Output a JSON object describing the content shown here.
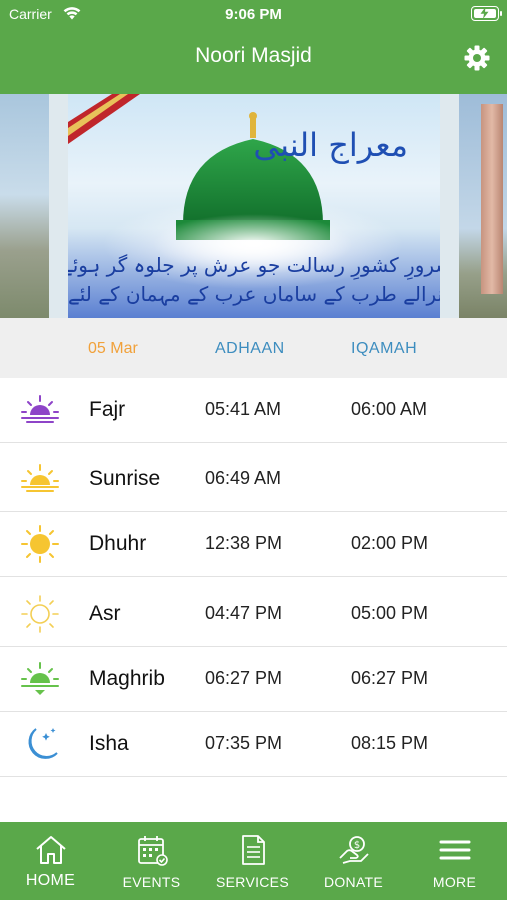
{
  "status_bar": {
    "carrier": "Carrier",
    "time": "9:06 PM",
    "icons": [
      "wifi-icon",
      "battery-charging-icon"
    ]
  },
  "header": {
    "title": "Noori Masjid",
    "settings_icon": "gear-icon"
  },
  "banner": {
    "caption_lines": [
      "وہ سرورِ کشورِ رسالت جو عرش پر جلوہ گر ہوئے تھے",
      "نئے نرالے طرب کے ساماں عرب کے مہمان کے لئے تھے"
    ],
    "title_art": "معراج النبی"
  },
  "table": {
    "date": "05 Mar",
    "adhaan_header": "ADHAAN",
    "iqamah_header": "IQAMAH",
    "prayers": [
      {
        "name": "Fajr",
        "adhaan": "05:41 AM",
        "iqamah": "06:00 AM",
        "icon": "sunrise-purple-icon",
        "color": "#8e44c8"
      },
      {
        "name": "Sunrise",
        "adhaan": "06:49 AM",
        "iqamah": "",
        "icon": "sunrise-yellow-icon",
        "color": "#f6c531"
      },
      {
        "name": "Dhuhr",
        "adhaan": "12:38 PM",
        "iqamah": "02:00 PM",
        "icon": "sun-icon",
        "color": "#f6c531"
      },
      {
        "name": "Asr",
        "adhaan": "04:47 PM",
        "iqamah": "05:00 PM",
        "icon": "sun-outline-icon",
        "color": "#f3cf55"
      },
      {
        "name": "Maghrib",
        "adhaan": "06:27 PM",
        "iqamah": "06:27 PM",
        "icon": "sunset-green-icon",
        "color": "#66c24b"
      },
      {
        "name": "Isha",
        "adhaan": "07:35 PM",
        "iqamah": "08:15 PM",
        "icon": "moon-stars-icon",
        "color": "#3b8fd4"
      }
    ]
  },
  "tabbar": {
    "items": [
      {
        "label": "HOME",
        "icon": "home-icon"
      },
      {
        "label": "EVENTS",
        "icon": "calendar-icon"
      },
      {
        "label": "SERVICES",
        "icon": "document-icon"
      },
      {
        "label": "DONATE",
        "icon": "donate-hand-icon"
      },
      {
        "label": "MORE",
        "icon": "menu-icon"
      }
    ]
  },
  "colors": {
    "brand_green": "#5aa84a",
    "date_orange": "#f1a13a",
    "header_blue": "#3d8dbf"
  }
}
